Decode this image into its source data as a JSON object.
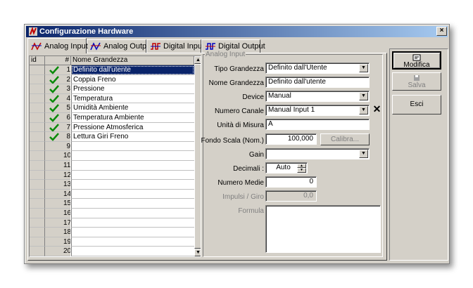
{
  "window": {
    "title": "Configurazione Hardware",
    "close_label": "×"
  },
  "tabs": [
    {
      "label": "Analog Input",
      "icon": "analog-wave-icon",
      "active": true
    },
    {
      "label": "Analog Output",
      "icon": "analog-wave-icon",
      "active": false
    },
    {
      "label": "Digital Input",
      "icon": "digital-wave-icon",
      "active": false
    },
    {
      "label": "Digital Output",
      "icon": "digital-wave-icon",
      "active": false
    }
  ],
  "grid": {
    "columns": {
      "id": "id",
      "num": "#",
      "name": "Nome Grandezza"
    },
    "rows": [
      {
        "num": "1",
        "name": "Definito dall'utente",
        "checked": true,
        "selected": true
      },
      {
        "num": "2",
        "name": "Coppia Freno",
        "checked": true
      },
      {
        "num": "3",
        "name": "Pressione",
        "checked": true
      },
      {
        "num": "4",
        "name": "Temperatura",
        "checked": true
      },
      {
        "num": "5",
        "name": "Umidità Ambiente",
        "checked": true
      },
      {
        "num": "6",
        "name": "Temperatura Ambiente",
        "checked": true
      },
      {
        "num": "7",
        "name": "Pressione Atmosferica",
        "checked": true
      },
      {
        "num": "8",
        "name": "Lettura Giri Freno",
        "checked": true
      },
      {
        "num": "9",
        "name": ""
      },
      {
        "num": "10",
        "name": ""
      },
      {
        "num": "11",
        "name": ""
      },
      {
        "num": "12",
        "name": ""
      },
      {
        "num": "13",
        "name": ""
      },
      {
        "num": "14",
        "name": ""
      },
      {
        "num": "15",
        "name": ""
      },
      {
        "num": "16",
        "name": ""
      },
      {
        "num": "17",
        "name": ""
      },
      {
        "num": "18",
        "name": ""
      },
      {
        "num": "19",
        "name": ""
      },
      {
        "num": "20",
        "name": ""
      }
    ]
  },
  "form": {
    "group_label": "Analog Input",
    "tipo_grandezza": {
      "label": "Tipo Grandezza",
      "value": "Definito dall'Utente"
    },
    "nome_grandezza": {
      "label": "Nome Grandezza",
      "value": "Definito dall'utente"
    },
    "device": {
      "label": "Device",
      "value": "Manual"
    },
    "numero_canale": {
      "label": "Numero Canale",
      "value": "Manual Input 1"
    },
    "unita_misura": {
      "label": "Unità di Misura",
      "value": "A"
    },
    "fondo_scala": {
      "label": "Fondo Scala (Nom.)",
      "value": "100,000"
    },
    "calibra": {
      "label": "Calibra..."
    },
    "gain": {
      "label": "Gain",
      "value": ""
    },
    "decimali": {
      "label": "Decimali :",
      "value": "Auto"
    },
    "numero_medie": {
      "label": "Numero Medie",
      "value": "0"
    },
    "impulsi_giro": {
      "label": "Impulsi / Giro",
      "value": "0,0"
    },
    "formula": {
      "label": "Formula",
      "value": ""
    }
  },
  "actions": {
    "modifica": "Modifica",
    "salva": "Salva",
    "esci": "Esci"
  }
}
